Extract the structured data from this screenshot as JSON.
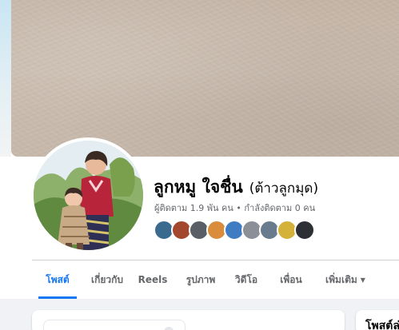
{
  "profile": {
    "name": "ลูกหมู ใจชื่น",
    "alternate_name": "(ต้าวลูกมุด)",
    "followers_text": "ผู้ติดตาม 1.9 พัน คน • กำลังติดตาม 0 คน"
  },
  "friend_avatars": [
    {
      "color": "#3a6b8f"
    },
    {
      "color": "#a3472f"
    },
    {
      "color": "#5a5e66"
    },
    {
      "color": "#d98c3c"
    },
    {
      "color": "#3f7cc4"
    },
    {
      "color": "#8a8f98"
    },
    {
      "color": "#6b7b8e"
    },
    {
      "color": "#d4b23a"
    },
    {
      "color": "#2c2f33"
    }
  ],
  "tabs": [
    {
      "label": "โพสต์",
      "active": true
    },
    {
      "label": "เกี่ยวกับ"
    },
    {
      "label": "Reels"
    },
    {
      "label": "รูปภาพ"
    },
    {
      "label": "วิดีโอ"
    },
    {
      "label": "เพื่อน"
    },
    {
      "label": "เพิ่มเติม"
    }
  ],
  "more_caret_icon": "caret-down-icon",
  "sidebar_card": {
    "title": "โพสต์ล่"
  },
  "colors": {
    "accent": "#1877f2",
    "text": "#050505",
    "secondary": "#65676b"
  }
}
